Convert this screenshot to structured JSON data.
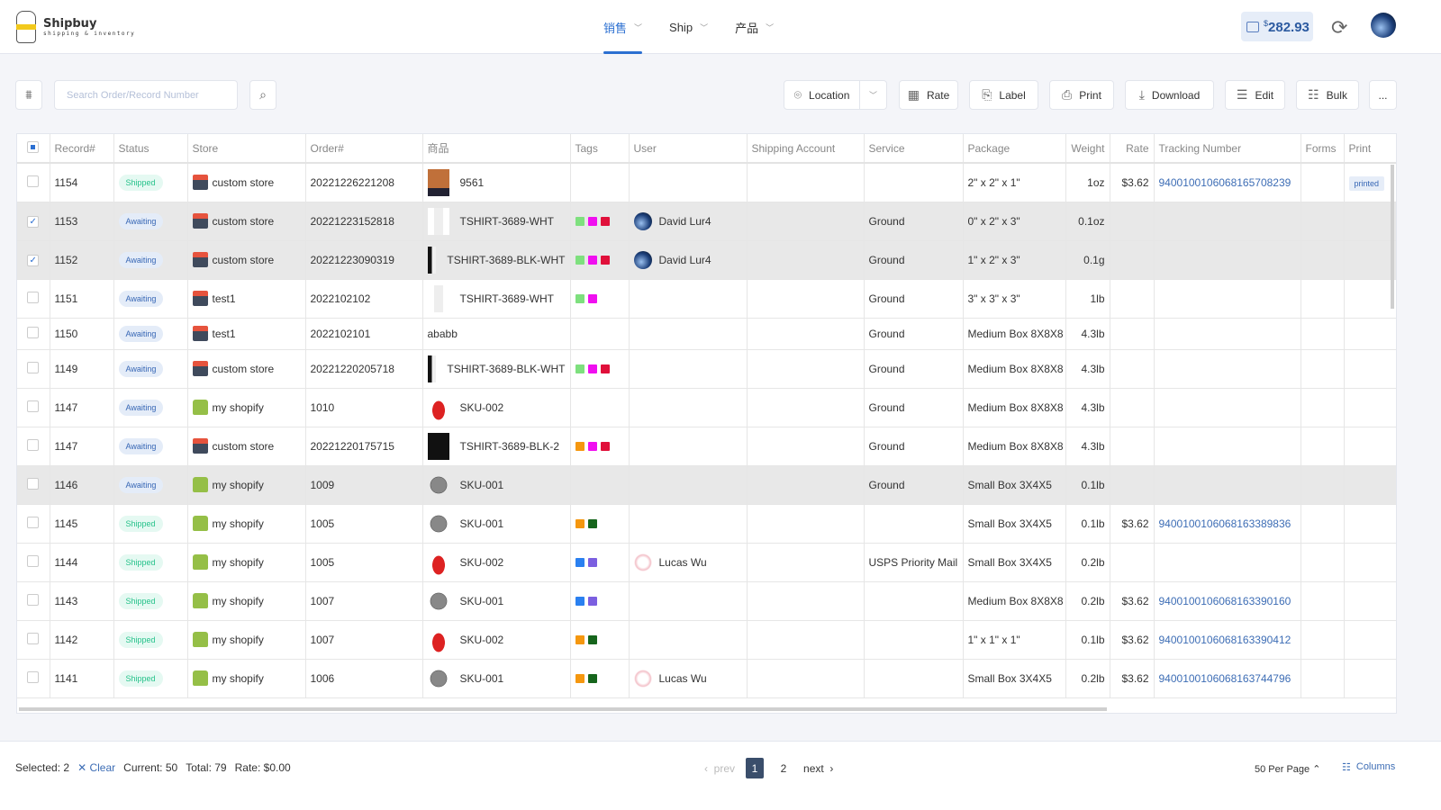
{
  "app": {
    "name": "Shipbuy",
    "tagline": "shipping & inventory"
  },
  "nav": [
    {
      "label": "销售",
      "active": true
    },
    {
      "label": "Ship",
      "active": false
    },
    {
      "label": "产品",
      "active": false
    }
  ],
  "balance": {
    "currency": "$",
    "amount": "282.93"
  },
  "search": {
    "placeholder": "Search Order/Record Number",
    "value": ""
  },
  "toolbar": {
    "location": "Location",
    "rate": "Rate",
    "label": "Label",
    "print": "Print",
    "download": "Download",
    "edit": "Edit",
    "bulk": "Bulk",
    "more": "..."
  },
  "columns": [
    "Record#",
    "Status",
    "Store",
    "Order#",
    "商品",
    "Tags",
    "User",
    "Shipping Account",
    "Service",
    "Package",
    "Weight",
    "Rate",
    "Tracking Number",
    "Forms",
    "Print"
  ],
  "tag_colors": {
    "green": "#7ee07e",
    "magenta": "#f00ff0",
    "red": "#e0103a",
    "orange": "#f5970f",
    "darkgreen": "#16651c",
    "blue": "#2a80f0",
    "purple": "#7b5fe0"
  },
  "rows": [
    {
      "record": "1154",
      "status": "Shipped",
      "store": "custom store",
      "store_type": "custom",
      "order": "20221226221208",
      "product": "9561",
      "product_img": "jacket",
      "tags": [],
      "user": "",
      "service": "",
      "package": "2\" x 2\" x 1\"",
      "weight": "1oz",
      "rate": "$3.62",
      "tracking": "9400100106068165708239",
      "print": "printed",
      "checked": false
    },
    {
      "record": "1153",
      "status": "Awaiting",
      "store": "custom store",
      "store_type": "custom",
      "order": "20221223152818",
      "product": "TSHIRT-3689-WHT",
      "product_img": "white-shirt",
      "tags": [
        "green",
        "magenta",
        "red"
      ],
      "user": "David Lur4",
      "user_av": "globe",
      "service": "Ground",
      "package": "0\" x 2\" x 3\"",
      "weight": "0.1oz",
      "rate": "",
      "tracking": "",
      "print": "",
      "checked": true
    },
    {
      "record": "1152",
      "status": "Awaiting",
      "store": "custom store",
      "store_type": "custom",
      "order": "20221223090319",
      "product": "TSHIRT-3689-BLK-WHT",
      "product_img": "bw-shirt",
      "tags": [
        "green",
        "magenta",
        "red"
      ],
      "user": "David Lur4",
      "user_av": "globe",
      "service": "Ground",
      "package": "1\" x 2\" x 3\"",
      "weight": "0.1g",
      "rate": "",
      "tracking": "",
      "print": "",
      "checked": true
    },
    {
      "record": "1151",
      "status": "Awaiting",
      "store": "test1",
      "store_type": "custom",
      "order": "2022102102",
      "product": "TSHIRT-3689-WHT",
      "product_img": "white-shirt",
      "tags": [
        "green",
        "magenta"
      ],
      "user": "",
      "service": "Ground",
      "package": "3\" x 3\" x 3\"",
      "weight": "1lb",
      "rate": "",
      "tracking": "",
      "print": "",
      "checked": false
    },
    {
      "record": "1150",
      "status": "Awaiting",
      "store": "test1",
      "store_type": "custom",
      "order": "2022102101",
      "product": "ababb",
      "product_img": "",
      "tags": [],
      "user": "",
      "service": "Ground",
      "package": "Medium Box 8X8X8",
      "weight": "4.3lb",
      "rate": "",
      "tracking": "",
      "print": "",
      "checked": false
    },
    {
      "record": "1149",
      "status": "Awaiting",
      "store": "custom store",
      "store_type": "custom",
      "order": "20221220205718",
      "product": "TSHIRT-3689-BLK-WHT",
      "product_img": "bw-shirt",
      "tags": [
        "green",
        "magenta",
        "red"
      ],
      "user": "",
      "service": "Ground",
      "package": "Medium Box 8X8X8",
      "weight": "4.3lb",
      "rate": "",
      "tracking": "",
      "print": "",
      "checked": false
    },
    {
      "record": "1147",
      "status": "Awaiting",
      "store": "my shopify",
      "store_type": "shopify",
      "order": "1010",
      "product": "SKU-002",
      "product_img": "car",
      "tags": [],
      "user": "",
      "service": "Ground",
      "package": "Medium Box 8X8X8",
      "weight": "4.3lb",
      "rate": "",
      "tracking": "",
      "print": "",
      "checked": false
    },
    {
      "record": "1147",
      "status": "Awaiting",
      "store": "custom store",
      "store_type": "custom",
      "order": "20221220175715",
      "product": "TSHIRT-3689-BLK-2",
      "product_img": "black-shirt",
      "tags": [
        "orange",
        "magenta",
        "red"
      ],
      "user": "",
      "service": "Ground",
      "package": "Medium Box 8X8X8",
      "weight": "4.3lb",
      "rate": "",
      "tracking": "",
      "print": "",
      "checked": false
    },
    {
      "record": "1146",
      "status": "Awaiting",
      "store": "my shopify",
      "store_type": "shopify",
      "order": "1009",
      "product": "SKU-001",
      "product_img": "cooker",
      "tags": [],
      "user": "",
      "service": "Ground",
      "package": "Small Box 3X4X5",
      "weight": "0.1lb",
      "rate": "",
      "tracking": "",
      "print": "",
      "checked": false,
      "hover": true
    },
    {
      "record": "1145",
      "status": "Shipped",
      "store": "my shopify",
      "store_type": "shopify",
      "order": "1005",
      "product": "SKU-001",
      "product_img": "cooker",
      "tags": [
        "orange",
        "darkgreen"
      ],
      "user": "",
      "service": "",
      "package": "Small Box 3X4X5",
      "weight": "0.1lb",
      "rate": "$3.62",
      "tracking": "9400100106068163389836",
      "print": "",
      "checked": false
    },
    {
      "record": "1144",
      "status": "Shipped",
      "store": "my shopify",
      "store_type": "shopify",
      "order": "1005",
      "product": "SKU-002",
      "product_img": "car",
      "tags": [
        "blue",
        "purple"
      ],
      "user": "Lucas Wu",
      "user_av": "anime",
      "service": "USPS Priority Mail",
      "package": "Small Box 3X4X5",
      "weight": "0.2lb",
      "rate": "",
      "tracking": "",
      "print": "",
      "checked": false
    },
    {
      "record": "1143",
      "status": "Shipped",
      "store": "my shopify",
      "store_type": "shopify",
      "order": "1007",
      "product": "SKU-001",
      "product_img": "cooker",
      "tags": [
        "blue",
        "purple"
      ],
      "user": "",
      "service": "",
      "package": "Medium Box 8X8X8",
      "weight": "0.2lb",
      "rate": "$3.62",
      "tracking": "9400100106068163390160",
      "print": "",
      "checked": false
    },
    {
      "record": "1142",
      "status": "Shipped",
      "store": "my shopify",
      "store_type": "shopify",
      "order": "1007",
      "product": "SKU-002",
      "product_img": "car",
      "tags": [
        "orange",
        "darkgreen"
      ],
      "user": "",
      "service": "",
      "package": "1\" x 1\" x 1\"",
      "weight": "0.1lb",
      "rate": "$3.62",
      "tracking": "9400100106068163390412",
      "print": "",
      "checked": false
    },
    {
      "record": "1141",
      "status": "Shipped",
      "store": "my shopify",
      "store_type": "shopify",
      "order": "1006",
      "product": "SKU-001",
      "product_img": "cooker",
      "tags": [
        "orange",
        "darkgreen"
      ],
      "user": "Lucas Wu",
      "user_av": "anime",
      "service": "",
      "package": "Small Box 3X4X5",
      "weight": "0.2lb",
      "rate": "$3.62",
      "tracking": "9400100106068163744796",
      "print": "",
      "checked": false
    }
  ],
  "footer": {
    "selected_label": "Selected:",
    "selected": "2",
    "clear": "✕ Clear",
    "current_label": "Current:",
    "current": "50",
    "total_label": "Total:",
    "total": "79",
    "rate_label": "Rate:",
    "rate": "$0.00",
    "prev": "prev",
    "pages": [
      "1",
      "2"
    ],
    "current_page": "1",
    "next": "next",
    "per_page": "50 Per Page ⌃",
    "columns": "Columns"
  }
}
